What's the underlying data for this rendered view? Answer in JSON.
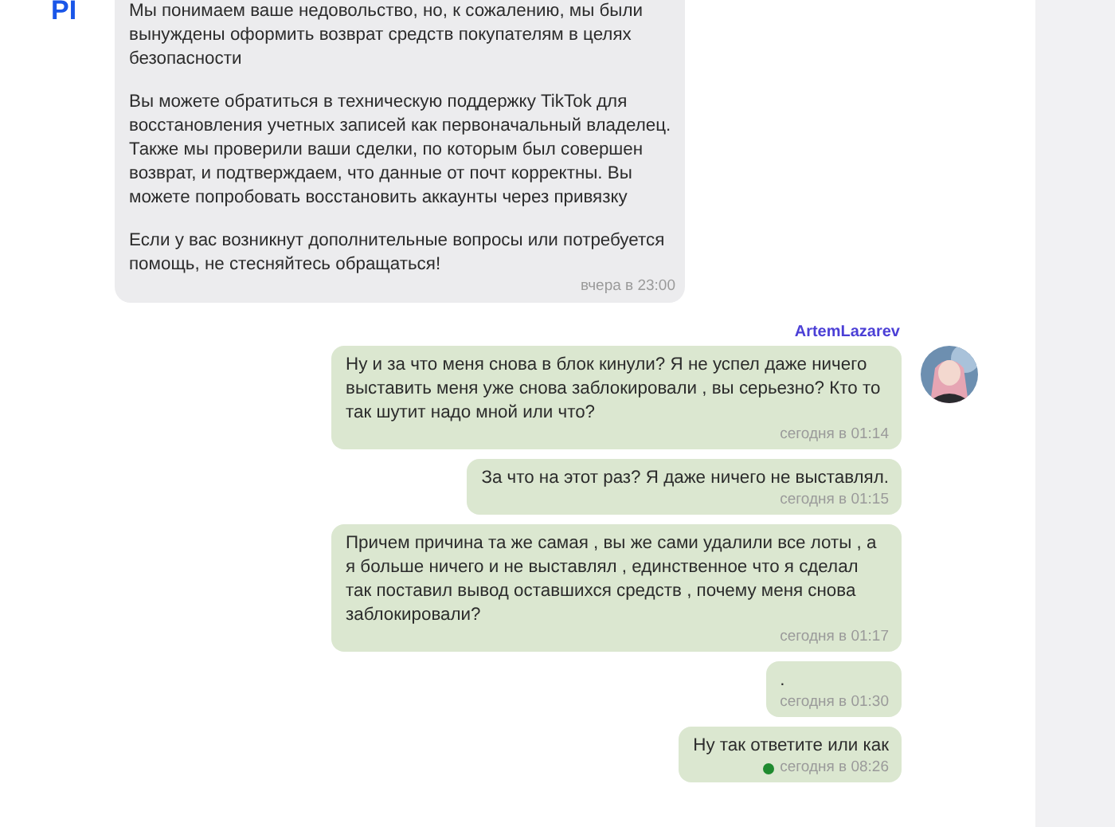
{
  "incoming": {
    "sender_logo": "PI",
    "paragraphs": [
      "Мы понимаем ваше недовольство, но, к сожалению, мы были вынуждены оформить возврат средств покупателям в целях безопасности",
      "Вы можете обратиться в техническую поддержку TikTok для восстановления учетных записей как первоначальный владелец. Также мы проверили ваши сделки, по которым был совершен возврат, и подтверждаем, что данные от почт корректны. Вы можете попробовать восстановить аккаунты через привязку",
      "Если у вас возникнут дополнительные вопросы или потребуется помощь, не стесняйтесь обращаться!"
    ],
    "time": "вчера в 23:00"
  },
  "outgoing": {
    "author": "ArtemLazarev",
    "messages": [
      {
        "text": "Ну и за что меня снова в блок кинули? Я не успел даже ничего выставить меня уже снова заблокировали , вы серьезно? Кто то так шутит надо мной или что?",
        "time": "сегодня в 01:14",
        "unread": false
      },
      {
        "text": "За что на этот раз? Я даже ничего не выставлял.",
        "time": "сегодня в 01:15",
        "unread": false
      },
      {
        "text": "Причем причина та же самая , вы же сами удалили все лоты , а я больше ничего и не выставлял , единственное что я сделал так поставил вывод оставшихся средств , почему меня снова заблокировали?",
        "time": "сегодня в 01:17",
        "unread": false
      },
      {
        "text": ".",
        "time": "сегодня в 01:30",
        "unread": false
      },
      {
        "text": "Ну так ответите или как",
        "time": "сегодня в 08:26",
        "unread": true
      }
    ]
  }
}
